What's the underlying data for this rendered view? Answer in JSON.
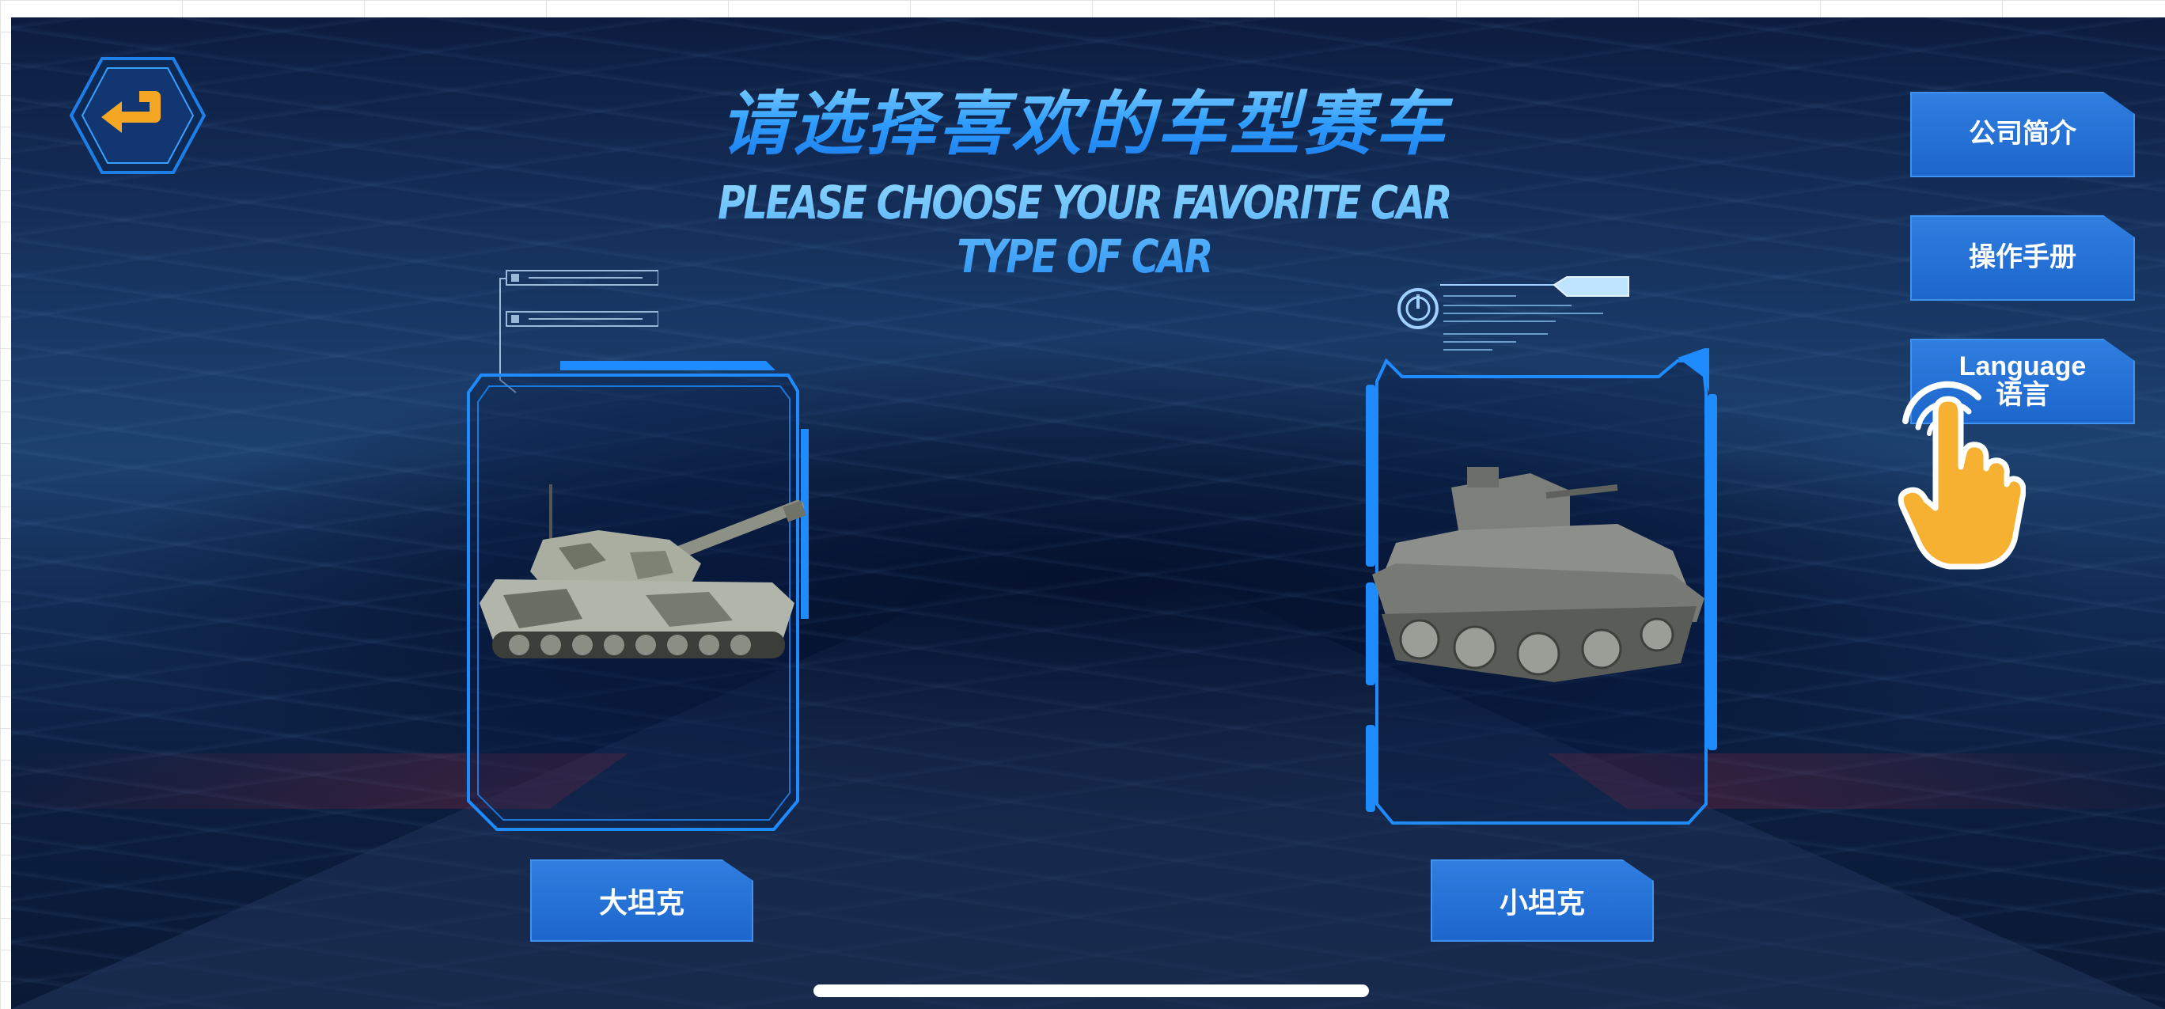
{
  "page": {
    "title_cn": "请选择喜欢的车型赛车",
    "title_en": "PLEASE CHOOSE YOUR FAVORITE CAR TYPE OF CAR"
  },
  "nav": {
    "back_icon": "return-arrow-icon"
  },
  "menu": {
    "company": "公司简介",
    "manual": "操作手册",
    "language_en": "Language",
    "language_cn": "语言"
  },
  "vehicles": [
    {
      "name": "大坦克",
      "icon": "big-tank-image"
    },
    {
      "name": "小坦克",
      "icon": "small-tank-image"
    }
  ],
  "overlay": {
    "pointer_icon": "tap-hand-icon"
  },
  "colors": {
    "accent_blue": "#1d66cc",
    "frame_blue": "#1e8cff",
    "title_blue": "#49b6ff",
    "back_arrow": "#f5a623"
  }
}
